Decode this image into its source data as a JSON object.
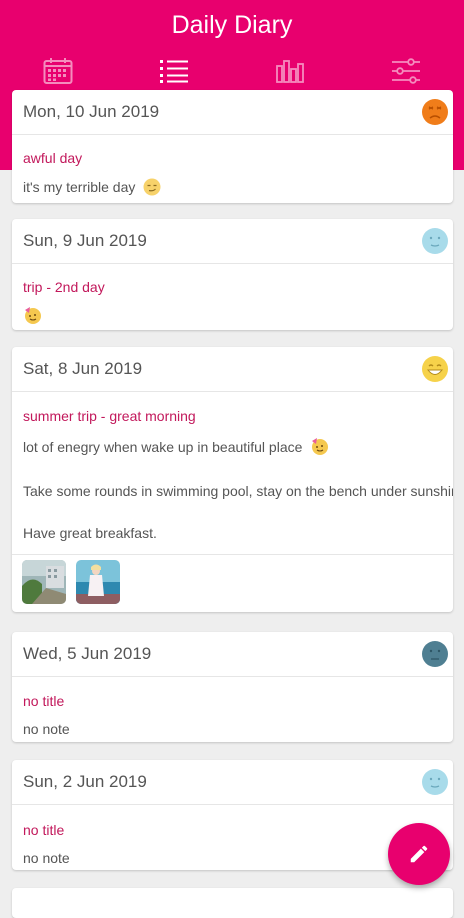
{
  "app": {
    "title": "Daily Diary"
  },
  "tabs": [
    {
      "name": "calendar-icon",
      "active": false
    },
    {
      "name": "list-icon",
      "active": true
    },
    {
      "name": "bar-chart-icon",
      "active": false
    },
    {
      "name": "sliders-icon",
      "active": false
    }
  ],
  "entries": [
    {
      "date": "Mon, 10 Jun 2019",
      "mood": "angry-face-icon",
      "mood_color": "#f07d1a",
      "title": "awful day",
      "notes": [
        "it's my terrible day"
      ],
      "note_emoji": "smirk-emoji-icon",
      "photos": []
    },
    {
      "date": "Sun, 9 Jun 2019",
      "mood": "calm-face-icon",
      "mood_color": "#a8dbea",
      "title": "trip - 2nd day",
      "notes": [],
      "note_emoji": "party-face-emoji-icon",
      "photos": []
    },
    {
      "date": "Sat, 8 Jun 2019",
      "mood": "happy-face-icon",
      "mood_color": "#f6d24a",
      "title": "summer trip - great morning",
      "notes": [
        "lot of enegry when wake up in beautiful place",
        "Take some rounds in swimming pool, stay on the bench under sunshine.",
        "Have great breakfast."
      ],
      "note_emoji": "party-face-emoji-icon",
      "photos": [
        "photo-thumbnail",
        "photo-thumbnail"
      ]
    },
    {
      "date": "Wed, 5 Jun 2019",
      "mood": "sad-face-icon",
      "mood_color": "#4f7f92",
      "title": "no title",
      "notes": [
        "no note"
      ],
      "photos": []
    },
    {
      "date": "Sun, 2 Jun 2019",
      "mood": "calm-face-icon",
      "mood_color": "#a8dbea",
      "title": "no title",
      "notes": [
        "no note"
      ],
      "photos": []
    }
  ],
  "fab": {
    "icon": "pencil-icon"
  }
}
